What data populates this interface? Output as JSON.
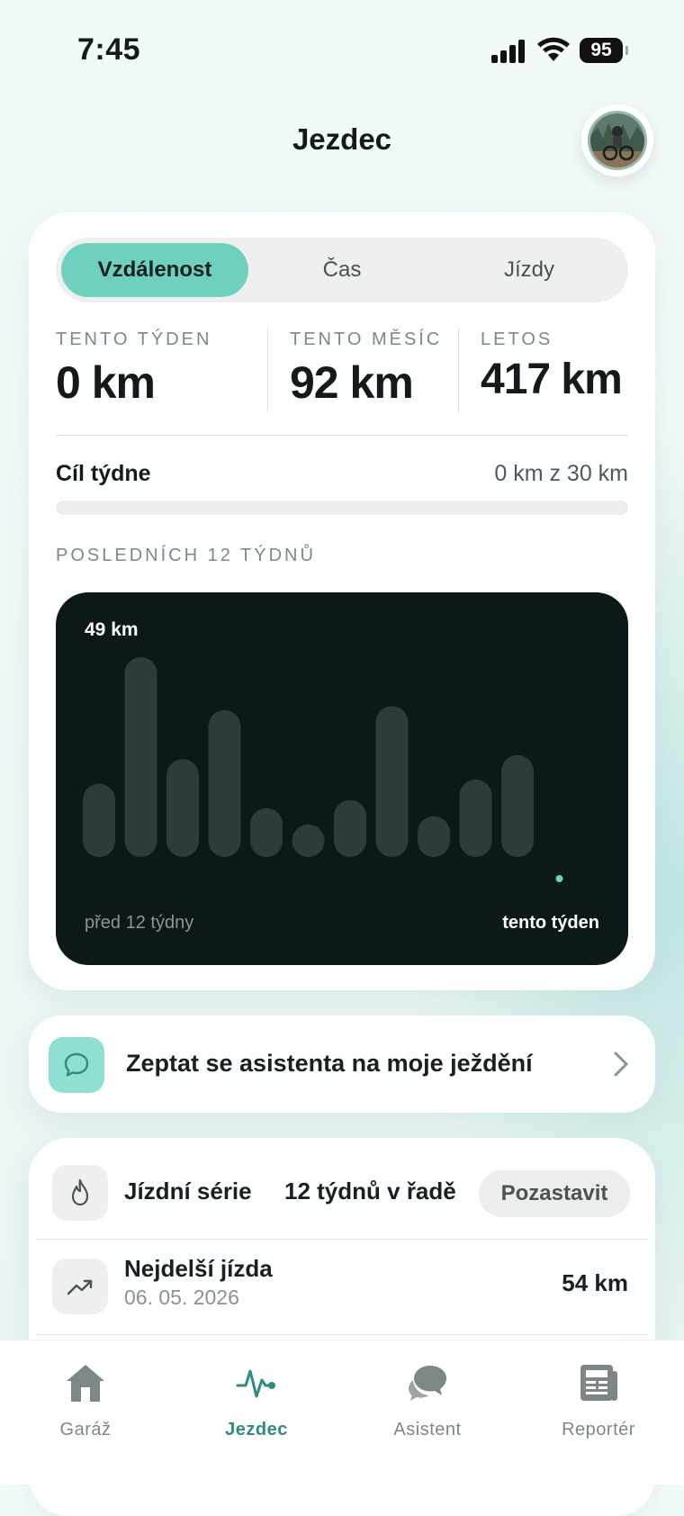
{
  "status": {
    "time": "7:45",
    "battery": "95"
  },
  "header": {
    "title": "Jezdec"
  },
  "segments": [
    {
      "label": "Vzdálenost",
      "active": true
    },
    {
      "label": "Čas",
      "active": false
    },
    {
      "label": "Jízdy",
      "active": false
    }
  ],
  "stats": [
    {
      "label": "TENTO TÝDEN",
      "value": "0 km"
    },
    {
      "label": "TENTO MĚSÍC",
      "value": "92 km"
    },
    {
      "label": "LETOS",
      "value": "417 km"
    }
  ],
  "goal": {
    "label": "Cíl týdne",
    "value": "0 km z 30 km",
    "progress": 0
  },
  "weeks": {
    "label": "POSLEDNÍCH 12 TÝDNŮ"
  },
  "chart_data": {
    "type": "bar",
    "max_label": "49 km",
    "start_label": "před 12 týdny",
    "end_label": "tento týden",
    "values": [
      18,
      49,
      24,
      36,
      12,
      8,
      14,
      37,
      10,
      19,
      25,
      0
    ],
    "ylim": [
      0,
      49
    ],
    "accent": "#6fd0bd",
    "bar_color": "#2f3a3a"
  },
  "ask": {
    "label": "Zeptat se asistenta na moje ježdění"
  },
  "streak": {
    "title": "Jízdní série",
    "value": "12 týdnů v řadě",
    "button": "Pozastavit"
  },
  "longest": {
    "title": "Nejdelší jízda",
    "date": "06. 05. 2026",
    "value": "54 km"
  },
  "tabs": [
    {
      "label": "Garáž",
      "icon": "home-icon",
      "active": false
    },
    {
      "label": "Jezdec",
      "icon": "activity-icon",
      "active": true
    },
    {
      "label": "Asistent",
      "icon": "chat-icon",
      "active": false
    },
    {
      "label": "Reportér",
      "icon": "newspaper-icon",
      "active": false
    }
  ],
  "colors": {
    "accent": "#6fd0bd",
    "accent_dark": "#2f8c80",
    "chart_bg": "#0d1818"
  }
}
